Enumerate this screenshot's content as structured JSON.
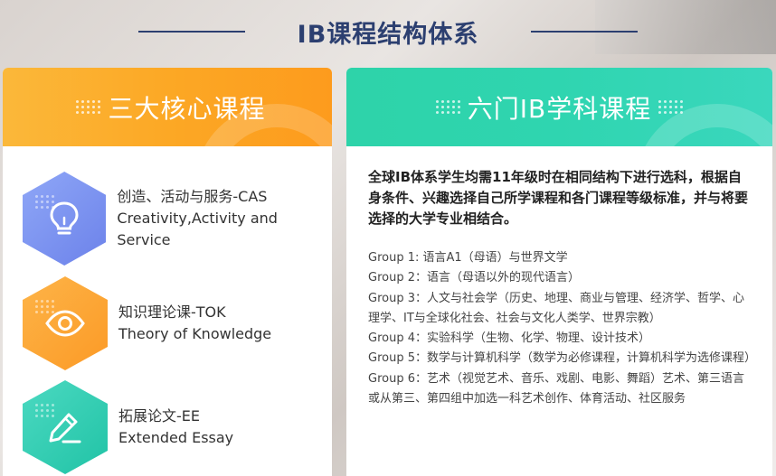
{
  "page": {
    "title": "IB课程结构体系"
  },
  "left_card": {
    "title": "三大核心课程",
    "courses": [
      {
        "icon": "lightbulb-icon",
        "title": "创造、活动与服务-CAS",
        "subtitle": "Creativity,Activity and Service"
      },
      {
        "icon": "eye-icon",
        "title": "知识理论课-TOK",
        "subtitle": "Theory of Knowledge"
      },
      {
        "icon": "pencil-icon",
        "title": "拓展论文-EE",
        "subtitle": "Extended Essay"
      }
    ]
  },
  "right_card": {
    "title": "六门IB学科课程",
    "intro": "全球IB体系学生均需11年级时在相同结构下进行选科，根据自身条件、兴趣选择自己所学课程和各门课程等级标准，并与将要选择的大学专业相结合。",
    "groups": [
      "Group 1: 语言A1（母语）与世界文学",
      "Group 2：语言（母语以外的现代语言）",
      "Group 3：人文与社会学（历史、地理、商业与管理、经济学、哲学、心理学、IT与全球化社会、社会与文化人类学、世界宗教）",
      "Group 4：实验科学（生物、化学、物理、设计技术）",
      "Group 5：数学与计算机科学（数学为必修课程，计算机科学为选修课程）",
      "Group 6：艺术（视觉艺术、音乐、戏剧、电影、舞蹈）艺术、第三语言或从第三、第四组中加选一科艺术创作、体育活动、社区服务"
    ]
  },
  "colors": {
    "title": "#2c3f70",
    "orange": "#fca825",
    "teal": "#2fd5b0",
    "blue_hex": "#7b92f0"
  }
}
